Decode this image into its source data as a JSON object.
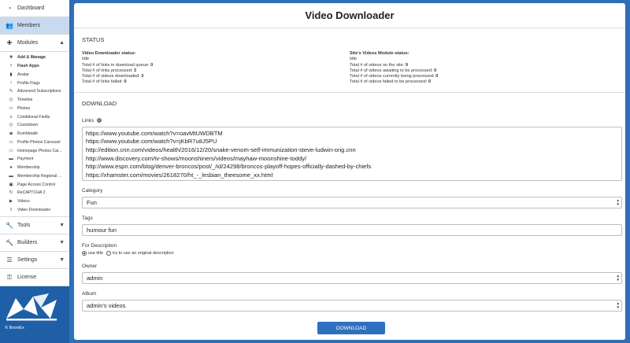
{
  "sidebar": {
    "dashboard": "Dashboard",
    "members": "Members",
    "modules": "Modules",
    "module_items": [
      {
        "label": "Add & Manage",
        "icon": "plus-icon",
        "bold": true
      },
      {
        "label": "Flash Apps",
        "icon": "bolt-icon",
        "bold": true
      },
      {
        "label": "Avatar",
        "icon": "user-icon"
      },
      {
        "label": "Profile Flags",
        "icon": "exclamation-icon"
      },
      {
        "label": "Advanced Subscriptions",
        "icon": "paperclip-icon"
      },
      {
        "label": "Timeline",
        "icon": "clock-icon"
      },
      {
        "label": "Photos",
        "icon": "image-icon"
      },
      {
        "label": "Conditional Fields",
        "icon": "list-icon"
      },
      {
        "label": "Countdown",
        "icon": "clock-icon"
      },
      {
        "label": "Rumbletalk",
        "icon": "chat-icon"
      },
      {
        "label": "Profile Photos Carousel",
        "icon": "image-icon"
      },
      {
        "label": "Homepage Photos Car...",
        "icon": "image-icon"
      },
      {
        "label": "Payment",
        "icon": "card-icon"
      },
      {
        "label": "Membership",
        "icon": "circle-icon"
      },
      {
        "label": "Membership Regional ...",
        "icon": "card-icon"
      },
      {
        "label": "Page Access Control",
        "icon": "lock-icon"
      },
      {
        "label": "ReCAPTCHA 2",
        "icon": "refresh-icon"
      },
      {
        "label": "Videos",
        "icon": "video-icon"
      },
      {
        "label": "Video Downloader",
        "icon": "download-icon"
      }
    ],
    "tools": "Tools",
    "builders": "Builders",
    "settings": "Settings",
    "license": "License",
    "copyright": "© BoonEx"
  },
  "page": {
    "title": "Video Downloader"
  },
  "status": {
    "heading": "STATUS",
    "left_title": "Video Downloader status:",
    "left_state": "Idle",
    "left_lines": [
      {
        "label": "Total # of links in download queue: ",
        "value": "0"
      },
      {
        "label": "Total # of links processed: ",
        "value": "3"
      },
      {
        "label": "Total # of videos downloaded: ",
        "value": "3"
      },
      {
        "label": "Total # of links failed: ",
        "value": "0"
      }
    ],
    "right_title": "Site's Videos Module status:",
    "right_state": "Idle",
    "right_lines": [
      {
        "label": "Total # of videos on the site: ",
        "value": "9"
      },
      {
        "label": "Total # of videos awaiting to be processed: ",
        "value": "0"
      },
      {
        "label": "Total # of videos currently being processed: ",
        "value": "0"
      },
      {
        "label": "Total # of videos failed to be processed: ",
        "value": "0"
      }
    ]
  },
  "download": {
    "heading": "DOWNLOAD",
    "links_label": "Links",
    "links": [
      "https://www.youtube.com/watch?v=oavMtUWDBTM",
      "https://www.youtube.com/watch?v=jKbR7u8J5PU",
      "http://edition.cnn.com/videos/health/2016/12/20/snake-venom-self-immunization-steve-ludwin-orig.cnn",
      "http://www.discovery.com/tv-shows/moonshiners/videos/mayhaw-moonshine-toddy/",
      "http://www.espn.com/blog/denver-broncos/post/_/id/24298/broncos-playoff-hopes-officially-dashed-by-chiefs",
      "https://xhamster.com/movies/2618270/ht_-_lesbian_theesome_xx.html"
    ],
    "category_label": "Category",
    "category_value": "Fun",
    "tags_label": "Tags",
    "tags_value": "humour fun",
    "description_label": "For Description",
    "radio_use_title": "use title",
    "radio_original": "try to use an original description",
    "owner_label": "Owner",
    "owner_value": "admin",
    "album_label": "Album",
    "album_value": "admin's videos",
    "button_label": "DOWNLOAD"
  }
}
